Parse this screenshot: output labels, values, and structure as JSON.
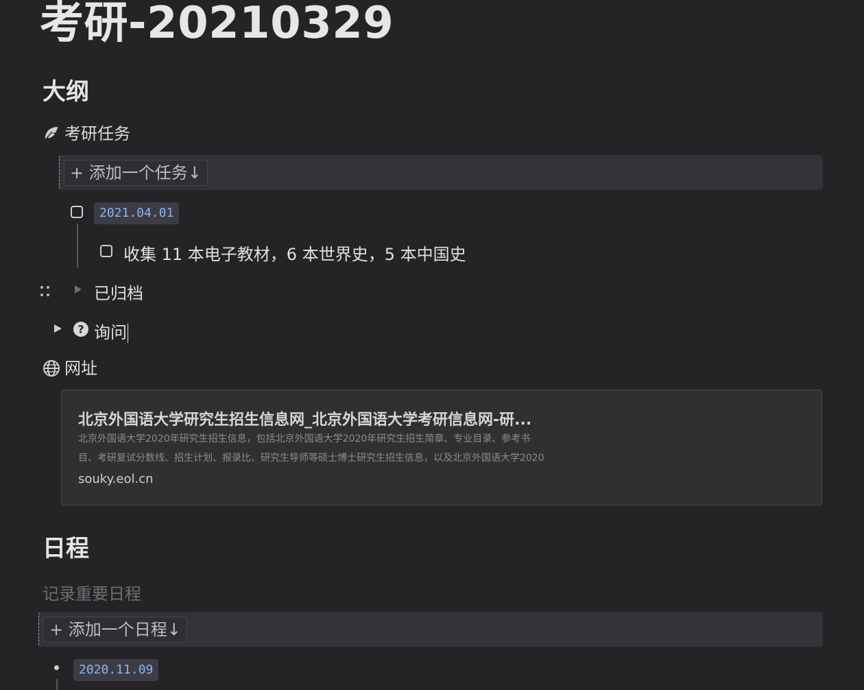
{
  "page": {
    "title": "考研-20210329"
  },
  "outline": {
    "heading": "大纲",
    "tasks_heading": "考研任务",
    "tasks_icon": "feather-icon",
    "add_task_label": "+ 添加一个任务↓",
    "task_date": "2021.04.01",
    "subtask_text": "收集 11 本电子教材，6 本世界史，5 本中国史",
    "archived_label": "已归档",
    "inquiry_label": "询问",
    "inquiry_icon": "question-circle-icon",
    "links_heading": "网址",
    "links_icon": "globe-icon"
  },
  "bookmark": {
    "title": "北京外国语大学研究生招生信息网_北京外国语大学考研信息网-研...",
    "desc_line1": "北京外国语大学2020年研究生招生信息，包括北京外国语大学2020年研究生招生简章、专业目录、参考书",
    "desc_line2": "目、考研复试分数线、招生计划、报录比、研究生导师等硕士博士研究生招生信息，以及北京外国语大学2020",
    "url": "souky.eol.cn"
  },
  "schedule": {
    "heading": "日程",
    "placeholder": "记录重要日程",
    "add_label": "+ 添加一个日程↓",
    "first_date": "2020.11.09"
  },
  "colors": {
    "background": "#242427",
    "date_tag_text": "#8ab4f8",
    "bar_background": "#333337"
  }
}
